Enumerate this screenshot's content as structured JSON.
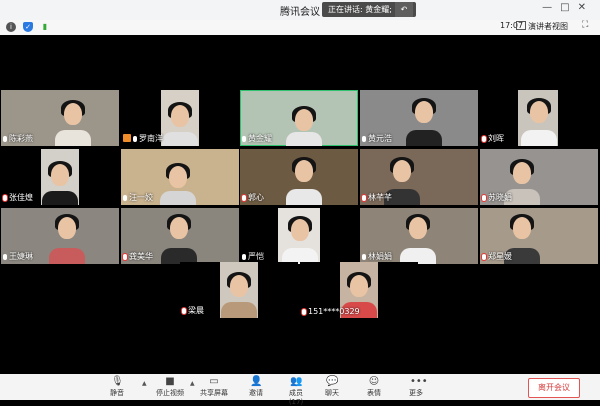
{
  "window": {
    "title": "腾讯会议",
    "controls": [
      "—",
      "□",
      "✕"
    ]
  },
  "speaking": {
    "label": "正在讲话: 黄金耀;"
  },
  "infobar": {
    "time": "17:07",
    "view_label": "演讲者视图"
  },
  "participants": [
    {
      "name": "陈彩燕",
      "icon": "mic-icon"
    },
    {
      "name": "罗南洋",
      "icon": "mic-icon",
      "host": true
    },
    {
      "name": "黄金耀",
      "icon": "mic-icon",
      "active": true
    },
    {
      "name": "黄元浩",
      "icon": "mic-icon"
    },
    {
      "name": "刘晖",
      "icon": "mic-muted-icon"
    },
    {
      "name": "张佳煌",
      "icon": "mic-muted-icon"
    },
    {
      "name": "汪一姣",
      "icon": "mic-icon"
    },
    {
      "name": "郭心",
      "icon": "mic-muted-icon"
    },
    {
      "name": "林芊芊",
      "icon": "mic-muted-icon"
    },
    {
      "name": "苏晓娟",
      "icon": "mic-muted-icon"
    },
    {
      "name": "王婕琳",
      "icon": "mic-icon"
    },
    {
      "name": "龚美华",
      "icon": "mic-muted-icon"
    },
    {
      "name": "严恺",
      "icon": "mic-icon"
    },
    {
      "name": "林娟娟",
      "icon": "mic-icon"
    },
    {
      "name": "郑星媛",
      "icon": "mic-muted-icon"
    },
    {
      "name": "梁晨",
      "icon": "mic-muted-icon"
    },
    {
      "name": "151****0329",
      "icon": "mic-muted-icon"
    }
  ],
  "toolbar": {
    "mute": "静音",
    "stop_video": "停止视频",
    "share": "共享屏幕",
    "invite": "邀请",
    "members": "成员(17)",
    "chat": "聊天",
    "emoji": "表情",
    "more": "更多",
    "leave": "离开会议"
  },
  "colors": {
    "active_border": "#2fc36f",
    "host_badge": "#f08d2b",
    "leave": "#d63c3c"
  }
}
